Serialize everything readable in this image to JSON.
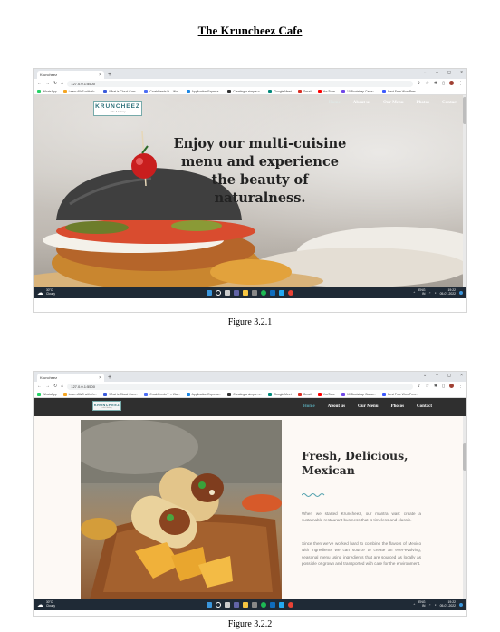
{
  "document": {
    "title": "The Kruncheez Cafe",
    "figure1_caption": "Figure 3.2.1",
    "figure2_caption": "Figure 3.2.2"
  },
  "browser": {
    "tab_label": "Kruncheez",
    "tab_close": "×",
    "new_tab": "+",
    "url": "127.0.0.1:5500",
    "window_controls": [
      "⌄",
      "–",
      "◻",
      "×"
    ],
    "bookmarks": [
      {
        "label": "WhatsApp",
        "color": "#25d366"
      },
      {
        "label": "Learn AWS with Yo...",
        "color": "#f5a623"
      },
      {
        "label": "What is Cloud Com...",
        "color": "#3b5bdb"
      },
      {
        "label": "CrushFeeds™ – Wa...",
        "color": "#4c6ef5"
      },
      {
        "label": "Application Express...",
        "color": "#1e88e5"
      },
      {
        "label": "Creating a simple n...",
        "color": "#333333"
      },
      {
        "label": "Google Meet",
        "color": "#00897b"
      },
      {
        "label": "Gmail",
        "color": "#d93025"
      },
      {
        "label": "YouTube",
        "color": "#ff0000"
      },
      {
        "label": "10 Bootstrap Carou...",
        "color": "#7048e8"
      },
      {
        "label": "Best Free WordPres...",
        "color": "#3d5afe"
      }
    ]
  },
  "taskbar": {
    "temperature": "30°C",
    "condition": "Cloudy",
    "language": "ENG",
    "region": "IN",
    "time": "19:22",
    "date": "05-07-2022"
  },
  "page1": {
    "logo_text": "KRUNCHEEZ",
    "logo_sub": "cafe & bakery",
    "nav": [
      "Home",
      "About us",
      "Our Menu",
      "Photos",
      "Contact"
    ],
    "hero_line1": "Enjoy our multi-cuisine",
    "hero_line2": "menu and experience",
    "hero_line3": "the beauty of naturalness."
  },
  "page2": {
    "nav": [
      "Home",
      "About us",
      "Our Menu",
      "Photos",
      "Contact"
    ],
    "title_line1": "Fresh, Delicious,",
    "title_line2": "Mexican",
    "paragraph1": "When we started Kruncheez, our mantra was: create a sustainable restaurant business that is timeless and classic.",
    "paragraph2": "Since then we've worked hard to combine the flavors of Mexico with ingredients we can source to create an ever-evolving, seasonal menu using ingredients that are sourced as locally as possible or grown and transported with care for the environment."
  },
  "colors": {
    "accent_teal": "#58a4b0",
    "nav_dark": "#2f2f2f",
    "taskbar": "#1f2a36"
  }
}
